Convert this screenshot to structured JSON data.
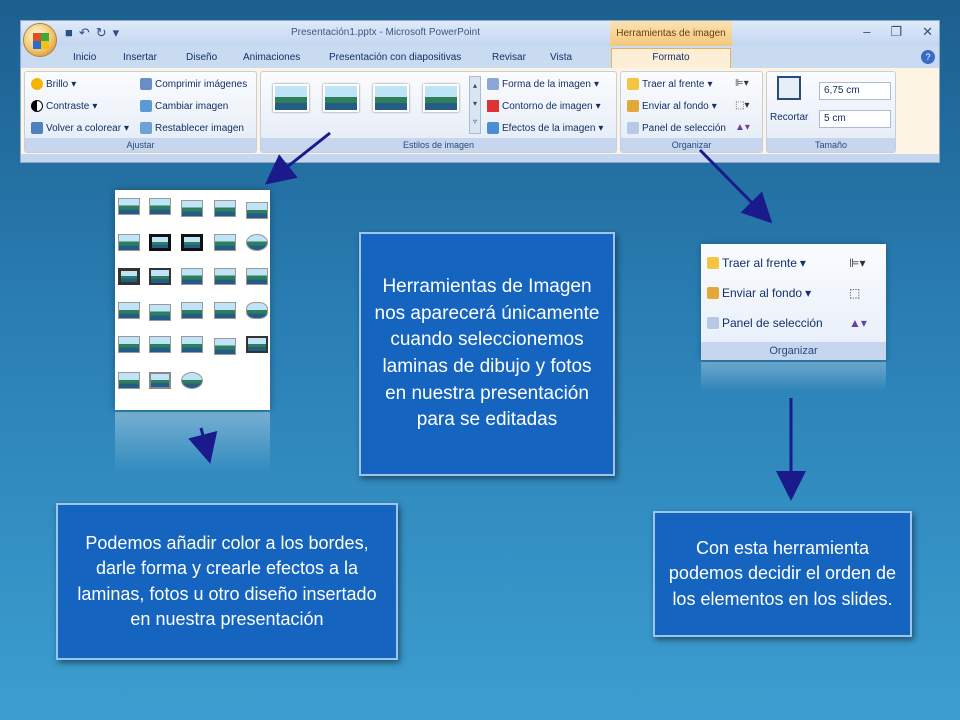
{
  "ribbon": {
    "window_title": "Presentación1.pptx - Microsoft PowerPoint",
    "context_tab_title": "Herramientas de imagen",
    "tabs": [
      "Inicio",
      "Insertar",
      "Diseño",
      "Animaciones",
      "Presentación con diapositivas",
      "Revisar",
      "Vista"
    ],
    "active_tab": "Formato",
    "groups": {
      "ajustar": {
        "label": "Ajustar",
        "commands": [
          "Brillo",
          "Contraste",
          "Volver a colorear",
          "Comprimir imágenes",
          "Cambiar imagen",
          "Restablecer imagen"
        ]
      },
      "estilos": {
        "label": "Estilos de imagen",
        "commands": [
          "Forma de la imagen",
          "Contorno de imagen",
          "Efectos de la imagen"
        ]
      },
      "organizar": {
        "label": "Organizar",
        "commands": [
          "Traer al frente",
          "Enviar al fondo",
          "Panel de selección"
        ]
      },
      "tamano": {
        "label": "Tamaño",
        "crop_label": "Recortar",
        "height_value": "6,75 cm",
        "width_value": "5 cm"
      }
    }
  },
  "organizar_zoom": {
    "commands": [
      "Traer al frente",
      "Enviar al fondo",
      "Panel de selección"
    ],
    "label": "Organizar"
  },
  "callouts": {
    "center": "Herramientas de Imagen nos aparecerá únicamente cuando seleccionemos laminas de dibujo y fotos en nuestra presentación para se editadas",
    "left": "Podemos añadir color a los bordes, darle forma y crearle efectos a la laminas, fotos u otro diseño insertado en nuestra presentación",
    "right": "Con esta herramienta podemos decidir  el orden de los elementos en los slides."
  },
  "colors": {
    "callout_fill": "#1565c0",
    "arrow": "#1a1a8c",
    "background": "#2a7fb4"
  }
}
